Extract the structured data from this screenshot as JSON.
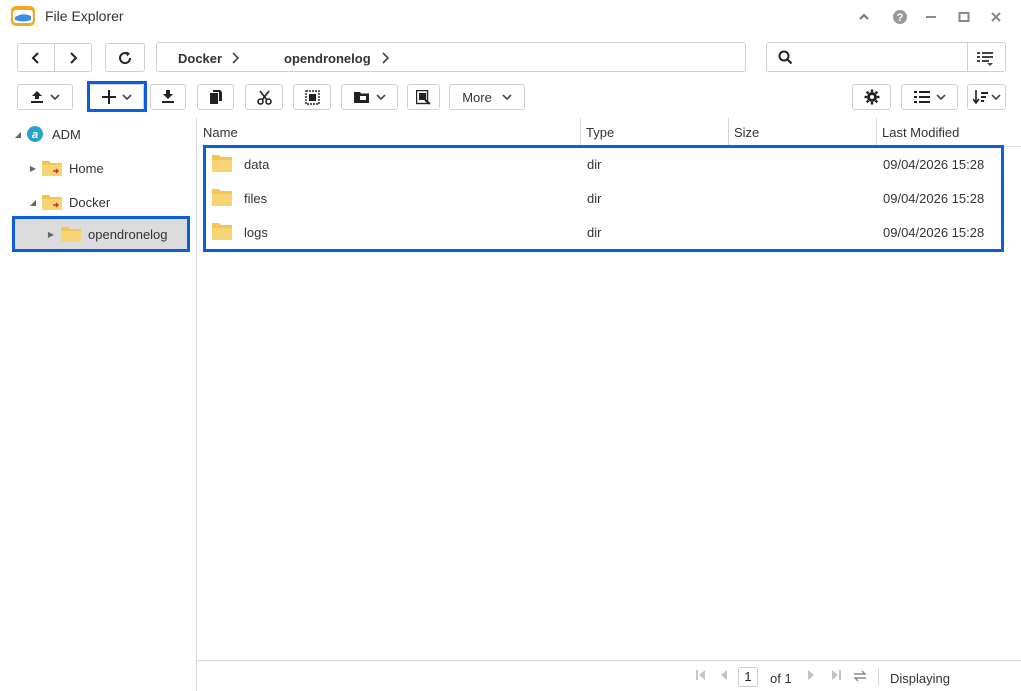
{
  "window": {
    "title": "File Explorer"
  },
  "breadcrumb": {
    "items": [
      "Docker",
      "opendronelog"
    ]
  },
  "search": {
    "value": "",
    "placeholder": ""
  },
  "toolbar": {
    "more_label": "More"
  },
  "sidebar": {
    "items": [
      {
        "label": "ADM",
        "icon": "adm-logo-icon"
      },
      {
        "label": "Home",
        "icon": "folder-icon"
      },
      {
        "label": "Docker",
        "icon": "folder-icon"
      },
      {
        "label": "opendronelog",
        "icon": "folder-icon"
      }
    ]
  },
  "table": {
    "columns": [
      "Name",
      "Type",
      "Size",
      "Last Modified"
    ],
    "rows": [
      {
        "name": "data",
        "type": "dir",
        "size": "",
        "modified": "09/04/2026 15:28"
      },
      {
        "name": "files",
        "type": "dir",
        "size": "",
        "modified": "09/04/2026 15:28"
      },
      {
        "name": "logs",
        "type": "dir",
        "size": "",
        "modified": "09/04/2026 15:28"
      }
    ]
  },
  "footer": {
    "page": "1",
    "of_label": "of 1",
    "displaying_label": "Displaying"
  },
  "colors": {
    "highlight": "#0a5fe0",
    "folder": "#f5c451",
    "selected_bg": "#dcdcdc"
  }
}
